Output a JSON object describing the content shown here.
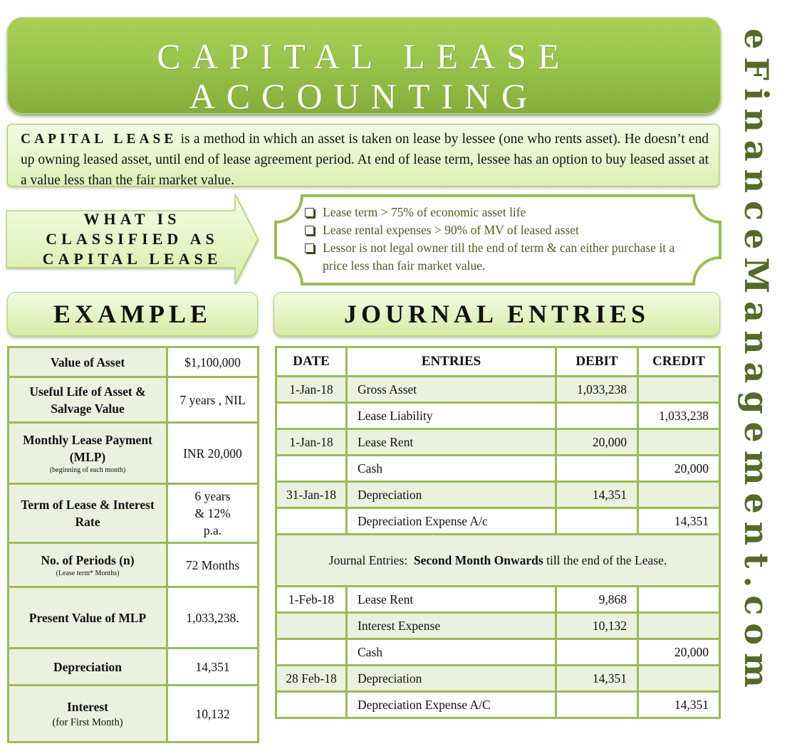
{
  "title": {
    "line1": "CAPITAL LEASE",
    "line2": "ACCOUNTING"
  },
  "definition": {
    "lead": "CAPITAL LEASE",
    "text": " is a method in which an asset is taken on lease by lessee (one who rents asset). He doesn’t end up owning leased asset, until end of lease agreement period. At end of lease term, lessee has an option to buy leased asset at a value less than the fair market value."
  },
  "classification": {
    "heading_lines": [
      "WHAT IS",
      "CLASSIFIED AS",
      "CAPITAL LEASE"
    ],
    "criteria": [
      "Lease term > 75% of economic asset life",
      "Lease rental expenses > 90% of MV of leased asset",
      "Lessor is not legal owner till the end of term & can either purchase it a price less than fair market value."
    ]
  },
  "example": {
    "heading": "EXAMPLE",
    "rows": [
      {
        "label": "Value of Asset",
        "note": "",
        "value": "$1,100,000"
      },
      {
        "label": "Useful Life of Asset & Salvage Value",
        "note": "",
        "value": "7 years , NIL"
      },
      {
        "label": "Monthly Lease Payment (MLP)",
        "note": "(beginning of each month)",
        "value": "INR 20,000"
      },
      {
        "label": "Term of Lease & Interest Rate",
        "note": "",
        "value": "6 years & 12% p.a."
      },
      {
        "label": "No. of Periods (n)",
        "note": "(Lease term* Months)",
        "value": "72 Months"
      },
      {
        "label": "Present Value of MLP",
        "note": "",
        "value": "1,033,238."
      },
      {
        "label": "Depreciation",
        "note": "",
        "value": "14,351"
      },
      {
        "label": "Interest",
        "note": "(for First Month)",
        "value": "10,132"
      }
    ]
  },
  "journal": {
    "heading": "JOURNAL ENTRIES",
    "columns": [
      "DATE",
      "ENTRIES",
      "DEBIT",
      "CREDIT"
    ],
    "rows_first": [
      {
        "date": "1-Jan-18",
        "entry": "Gross Asset",
        "debit": "1,033,238",
        "credit": ""
      },
      {
        "date": "",
        "entry": "Lease Liability",
        "debit": "",
        "credit": "1,033,238"
      },
      {
        "date": "1-Jan-18",
        "entry": "Lease Rent",
        "debit": "20,000",
        "credit": ""
      },
      {
        "date": "",
        "entry": "Cash",
        "debit": "",
        "credit": "20,000"
      },
      {
        "date": "31-Jan-18",
        "entry": "Depreciation",
        "debit": "14,351",
        "credit": ""
      },
      {
        "date": "",
        "entry": "Depreciation Expense A/c",
        "debit": "",
        "credit": "14,351"
      }
    ],
    "note": {
      "prefix": "Journal Entries:  ",
      "bold": "Second Month Onwards",
      "suffix": " till the end of the Lease."
    },
    "rows_second": [
      {
        "date": "1-Feb-18",
        "entry": "Lease Rent",
        "debit": "9,868",
        "credit": ""
      },
      {
        "date": "",
        "entry": "Interest Expense",
        "debit": "10,132",
        "credit": ""
      },
      {
        "date": "",
        "entry": "Cash",
        "debit": "",
        "credit": "20,000"
      },
      {
        "date": "28 Feb-18",
        "entry": "Depreciation",
        "debit": "14,351",
        "credit": ""
      },
      {
        "date": "",
        "entry": "Depreciation Expense  A/C",
        "debit": "",
        "credit": "14,351"
      }
    ]
  },
  "watermark": "eFinanceManagement.com",
  "colors": {
    "brand_green": "#9bbb59",
    "title_green": "#98c24a",
    "watermark_olive": "#55692a",
    "row_shade": "#ebf1de"
  }
}
